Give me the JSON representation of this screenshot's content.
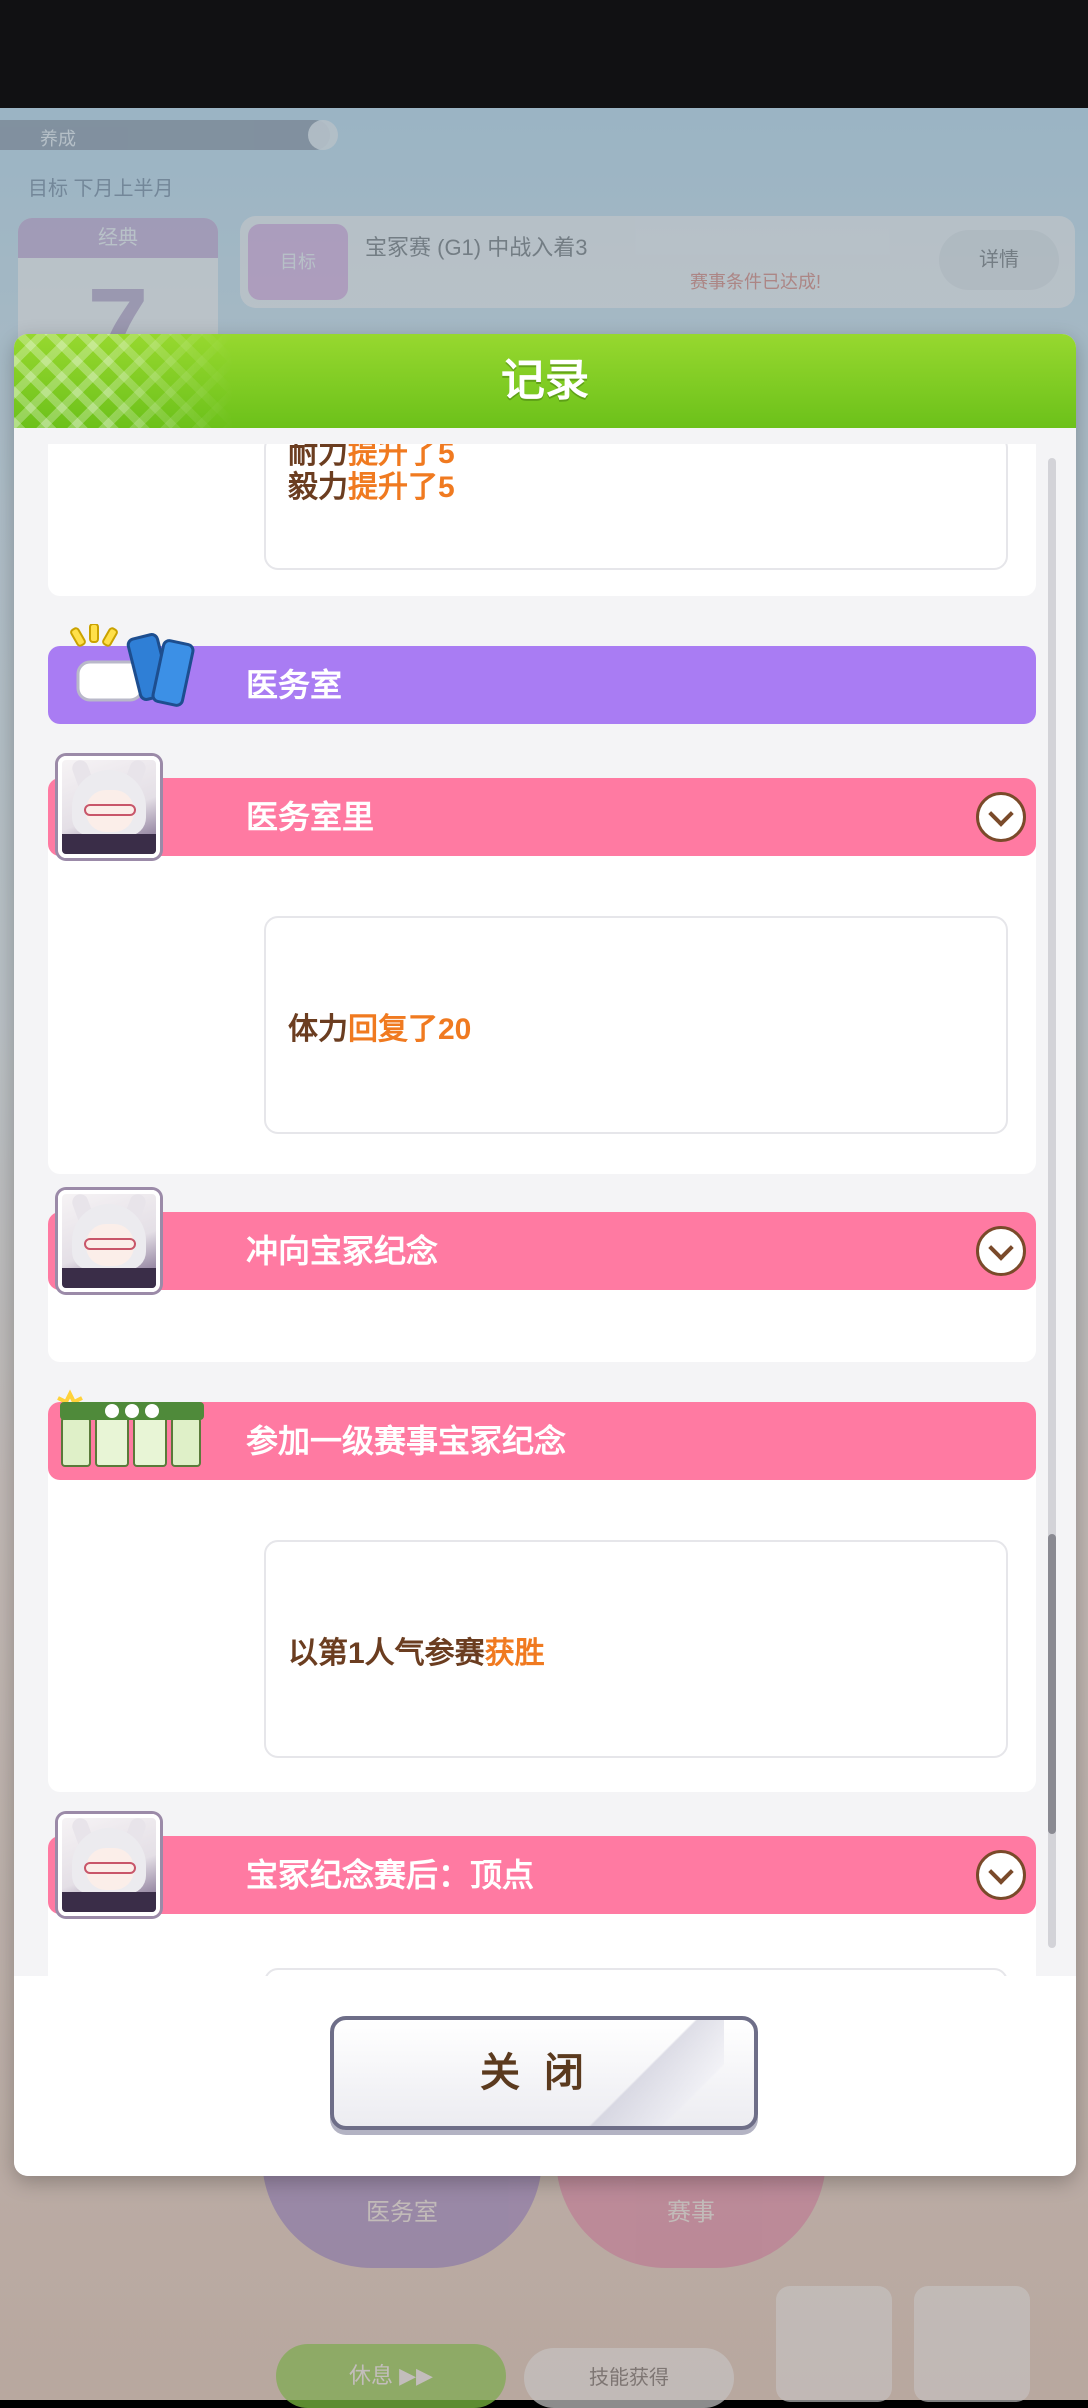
{
  "background": {
    "top_label": "养成",
    "sub_label": "目标 下月上半月",
    "calendar_header": "经典",
    "calendar_number": "7",
    "banner_tag": "目标",
    "banner_title": "宝冢赛 (G1) 中战入着3",
    "banner_note": "赛事条件已达成!",
    "banner_button": "详情",
    "btn_infirmary": "医务室",
    "btn_race": "赛事",
    "btn_green": "休息 ▶▶",
    "btn_white": "技能获得"
  },
  "dialog": {
    "title": "记录",
    "close_label": "关闭"
  },
  "records": {
    "prev_line1_label": "耐力",
    "prev_line1_value": "提升了5",
    "prev_line2_label": "毅力",
    "prev_line2_value": "提升了5",
    "section_infirmary": "医务室",
    "event_infirmary_inside": "医务室里",
    "event_infirmary_result_label": "体力",
    "event_infirmary_result_value": "回复了20",
    "event_toward_takarazuka": "冲向宝冢纪念",
    "section_race": "参加一级赛事宝冢纪念",
    "race_result_label": "以第1人气参赛",
    "race_result_value": "获胜",
    "event_after_race": "宝冢纪念赛后：顶点"
  },
  "colors": {
    "header_green": "#7cc91f",
    "section_purple": "#a97cf3",
    "event_pink": "#ff7aa2",
    "highlight_orange": "#f07a20",
    "text_brown": "#6b3d20"
  }
}
